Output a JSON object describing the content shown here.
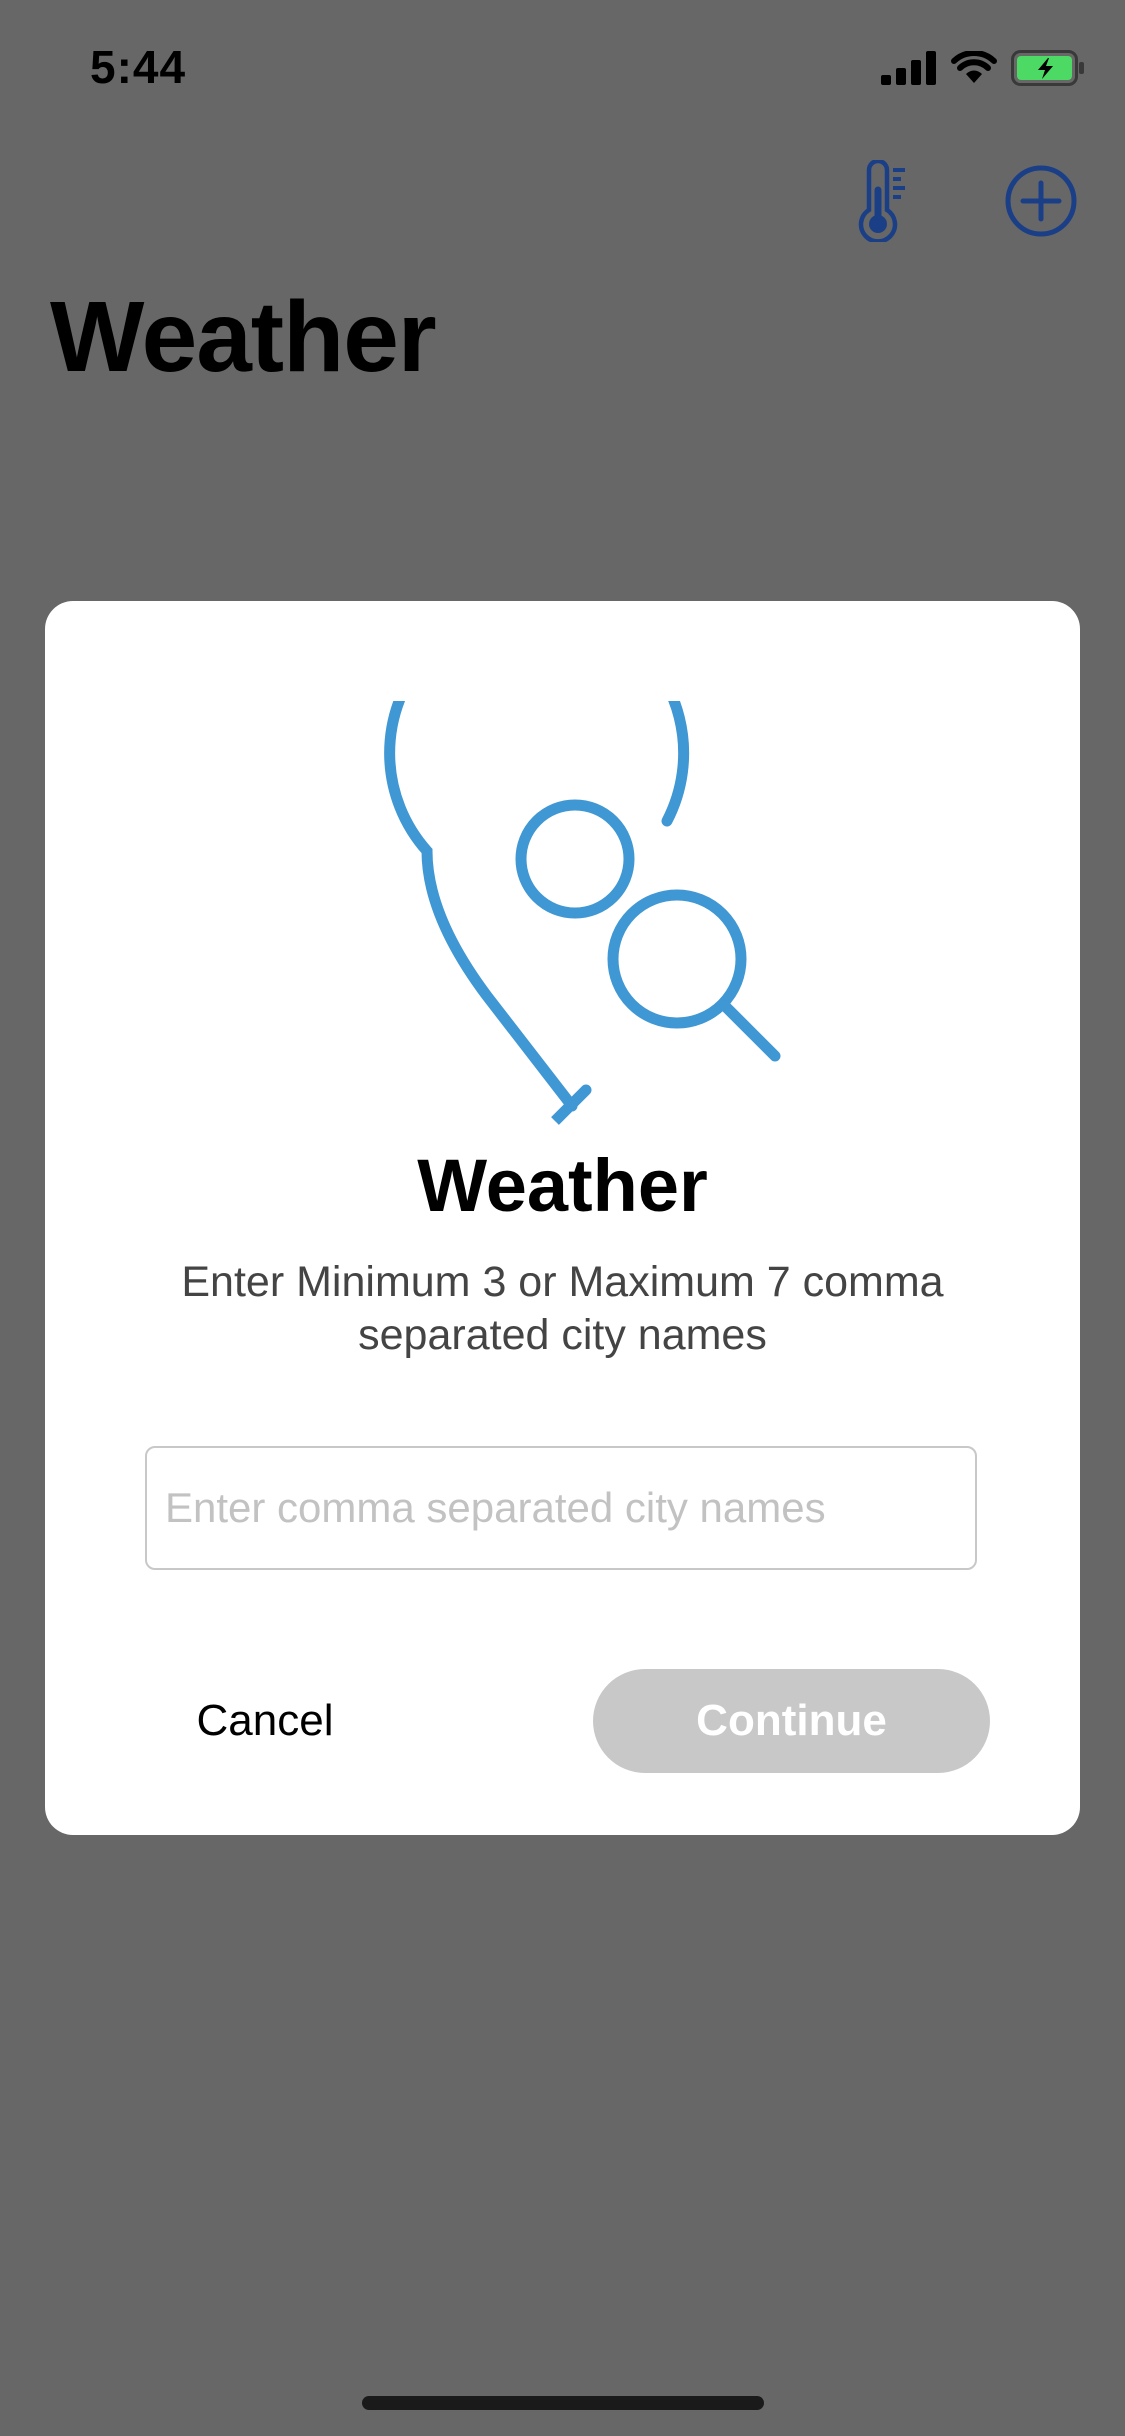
{
  "status_bar": {
    "time": "5:44",
    "icons": [
      "cellular-signal-icon",
      "wifi-icon",
      "battery-charging-icon"
    ],
    "battery_color": "#4cd964"
  },
  "nav": {
    "icons": [
      "thermometer-icon",
      "add-circle-icon"
    ],
    "title": "Weather",
    "accent_color": "#1b3f87"
  },
  "alert": {
    "icon": "location-search-icon",
    "icon_color": "#3f97d3",
    "title": "Weather",
    "message": "Enter Minimum 3 or Maximum 7 comma separated city names",
    "input": {
      "value": "",
      "placeholder": "Enter comma separated city names"
    },
    "cancel_label": "Cancel",
    "continue_label": "Continue",
    "continue_disabled_color": "#c8c8c8"
  },
  "backdrop_color": "#676767"
}
